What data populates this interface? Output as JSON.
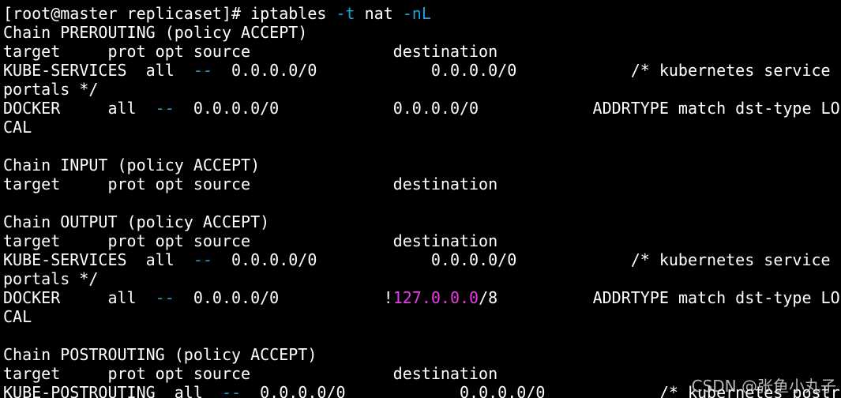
{
  "colors": {
    "background": "#000000",
    "text": "#ffffff",
    "flag": "#1aa3d3",
    "dashes": "#1aa3d3",
    "ip_highlight": "#e63ce6"
  },
  "lines": [
    [
      {
        "t": "[root@master replicaset]# iptables ",
        "c": "text"
      },
      {
        "t": "-t",
        "c": "flag"
      },
      {
        "t": " nat ",
        "c": "text"
      },
      {
        "t": "-nL",
        "c": "flag"
      }
    ],
    [
      {
        "t": "Chain PREROUTING (policy ACCEPT)",
        "c": "text"
      }
    ],
    [
      {
        "t": "target     prot opt source               destination",
        "c": "text"
      }
    ],
    [
      {
        "t": "KUBE-SERVICES  all  ",
        "c": "text"
      },
      {
        "t": "--",
        "c": "dashes"
      },
      {
        "t": "  0.0.0.0/0            0.0.0.0/0            /* kubernetes service",
        "c": "text"
      }
    ],
    [
      {
        "t": "portals */",
        "c": "text"
      }
    ],
    [
      {
        "t": "DOCKER     all  ",
        "c": "text"
      },
      {
        "t": "--",
        "c": "dashes"
      },
      {
        "t": "  0.0.0.0/0            0.0.0.0/0            ADDRTYPE match dst-type LO",
        "c": "text"
      }
    ],
    [
      {
        "t": "CAL",
        "c": "text"
      }
    ],
    [
      {
        "t": "",
        "c": "text"
      }
    ],
    [
      {
        "t": "Chain INPUT (policy ACCEPT)",
        "c": "text"
      }
    ],
    [
      {
        "t": "target     prot opt source               destination",
        "c": "text"
      }
    ],
    [
      {
        "t": "",
        "c": "text"
      }
    ],
    [
      {
        "t": "Chain OUTPUT (policy ACCEPT)",
        "c": "text"
      }
    ],
    [
      {
        "t": "target     prot opt source               destination",
        "c": "text"
      }
    ],
    [
      {
        "t": "KUBE-SERVICES  all  ",
        "c": "text"
      },
      {
        "t": "--",
        "c": "dashes"
      },
      {
        "t": "  0.0.0.0/0            0.0.0.0/0            /* kubernetes service",
        "c": "text"
      }
    ],
    [
      {
        "t": "portals */",
        "c": "text"
      }
    ],
    [
      {
        "t": "DOCKER     all  ",
        "c": "text"
      },
      {
        "t": "--",
        "c": "dashes"
      },
      {
        "t": "  0.0.0.0/0           !",
        "c": "text"
      },
      {
        "t": "127.0.0.0",
        "c": "ip_highlight"
      },
      {
        "t": "/8          ADDRTYPE match dst-type LO",
        "c": "text"
      }
    ],
    [
      {
        "t": "CAL",
        "c": "text"
      }
    ],
    [
      {
        "t": "",
        "c": "text"
      }
    ],
    [
      {
        "t": "Chain POSTROUTING (policy ACCEPT)",
        "c": "text"
      }
    ],
    [
      {
        "t": "target     prot opt source               destination",
        "c": "text"
      }
    ],
    [
      {
        "t": "KUBE-POSTROUTING  all  ",
        "c": "text"
      },
      {
        "t": "--",
        "c": "dashes"
      },
      {
        "t": "  0.0.0.0/0            0.0.0.0/0            /* kubernetes postr",
        "c": "text"
      }
    ]
  ],
  "watermark": "CSDN @张鱼小丸子"
}
